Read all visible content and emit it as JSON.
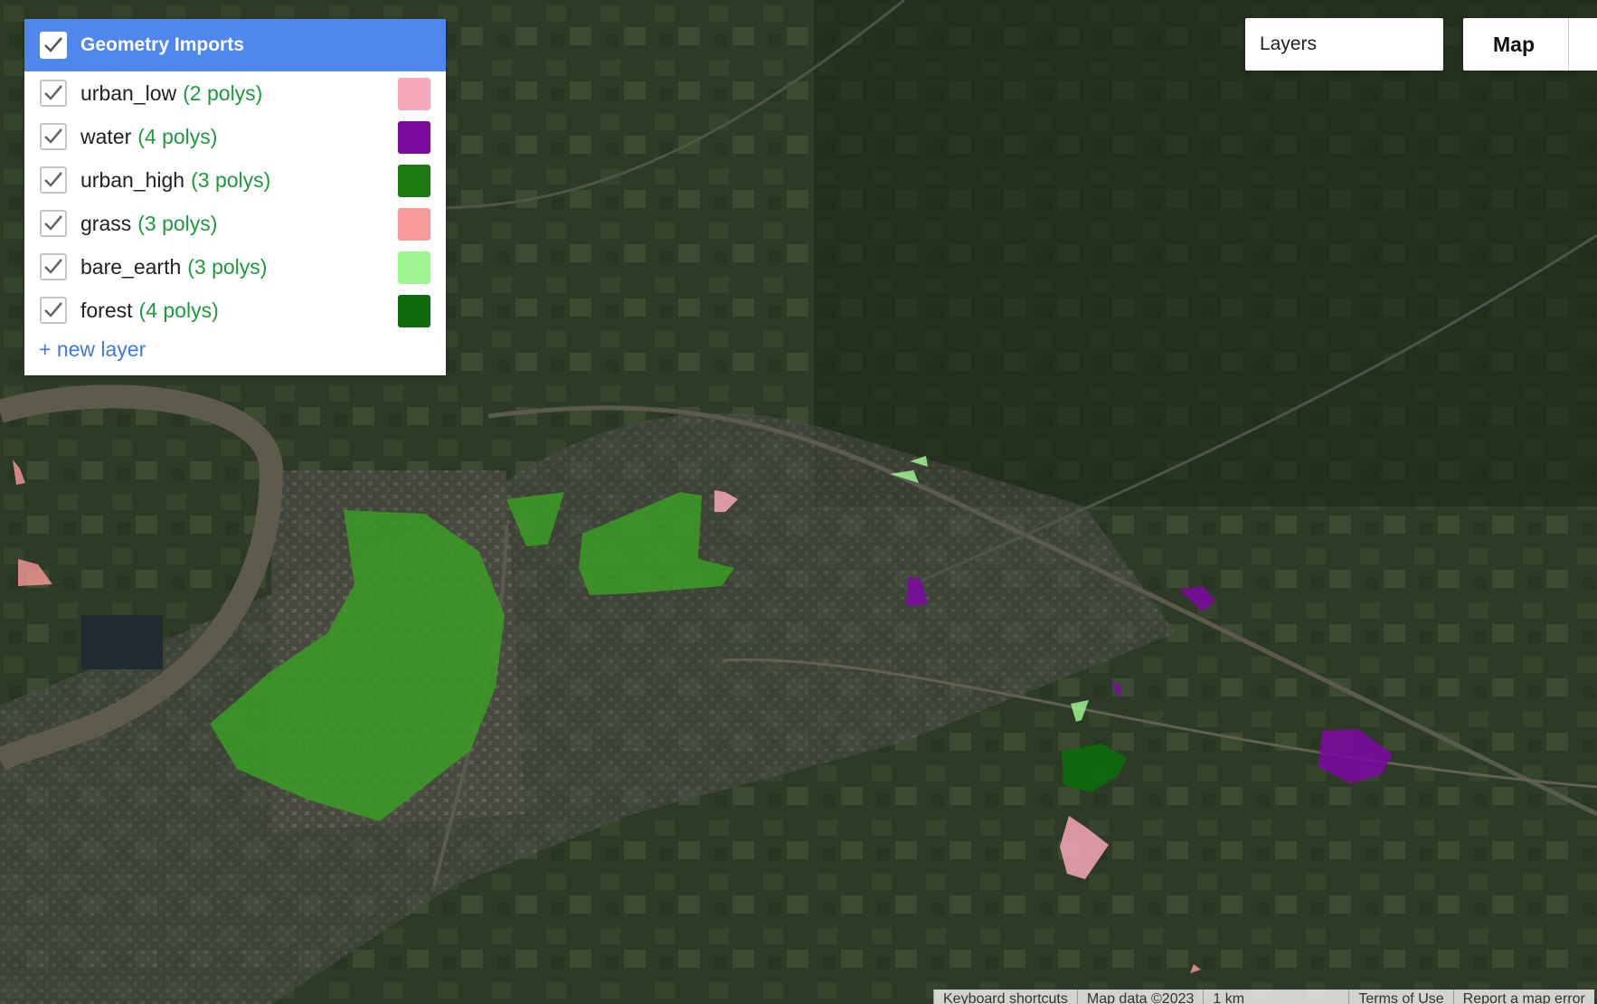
{
  "geometry_imports": {
    "title": "Geometry Imports",
    "layers": [
      {
        "name": "urban_low",
        "count": "(2 polys)",
        "color": "#f7a8ba"
      },
      {
        "name": "water",
        "count": "(4 polys)",
        "color": "#7b0a9e"
      },
      {
        "name": "urban_high",
        "count": "(3 polys)",
        "color": "#1b7a12"
      },
      {
        "name": "grass",
        "count": "(3 polys)",
        "color": "#f99a9a"
      },
      {
        "name": "bare_earth",
        "count": "(3 polys)",
        "color": "#9ef592"
      },
      {
        "name": "forest",
        "count": "(4 polys)",
        "color": "#0d6a0d"
      }
    ],
    "new_layer_label": "+ new layer"
  },
  "controls": {
    "layers_label": "Layers",
    "map_label": "Map"
  },
  "footer": {
    "keyboard": "Keyboard shortcuts",
    "map_data": "Map data ©2023",
    "scale": "1 km",
    "terms": "Terms of Use",
    "report": "Report a map error"
  }
}
